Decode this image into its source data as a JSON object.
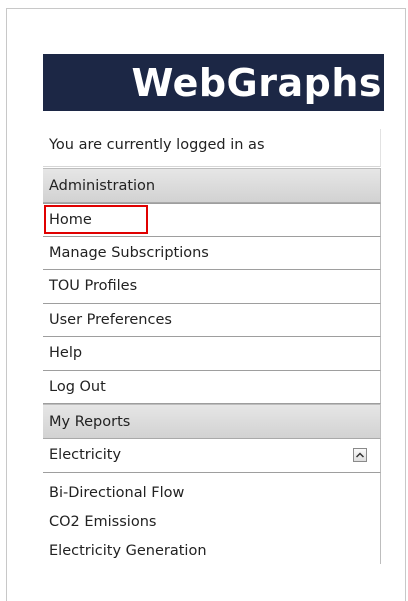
{
  "logo": {
    "text": "WebGraphs",
    "background": "#1c2745"
  },
  "login_status": {
    "text": "You are currently logged in as"
  },
  "administration": {
    "header": "Administration",
    "items": [
      {
        "label": "Home",
        "highlighted": true
      },
      {
        "label": "Manage Subscriptions"
      },
      {
        "label": "TOU Profiles"
      },
      {
        "label": "User Preferences"
      },
      {
        "label": "Help"
      },
      {
        "label": "Log Out"
      }
    ]
  },
  "my_reports": {
    "header": "My Reports",
    "category": {
      "label": "Electricity",
      "toggle_icon": "chevron-up-icon",
      "expanded": true
    },
    "reports": [
      {
        "label": "Bi-Directional Flow"
      },
      {
        "label": "CO2 Emissions"
      },
      {
        "label": "Electricity Generation"
      }
    ]
  },
  "colors": {
    "highlight_border": "#e00000",
    "header_gradient_top": "#e6e6e6",
    "header_gradient_bottom": "#d2d2d2"
  }
}
